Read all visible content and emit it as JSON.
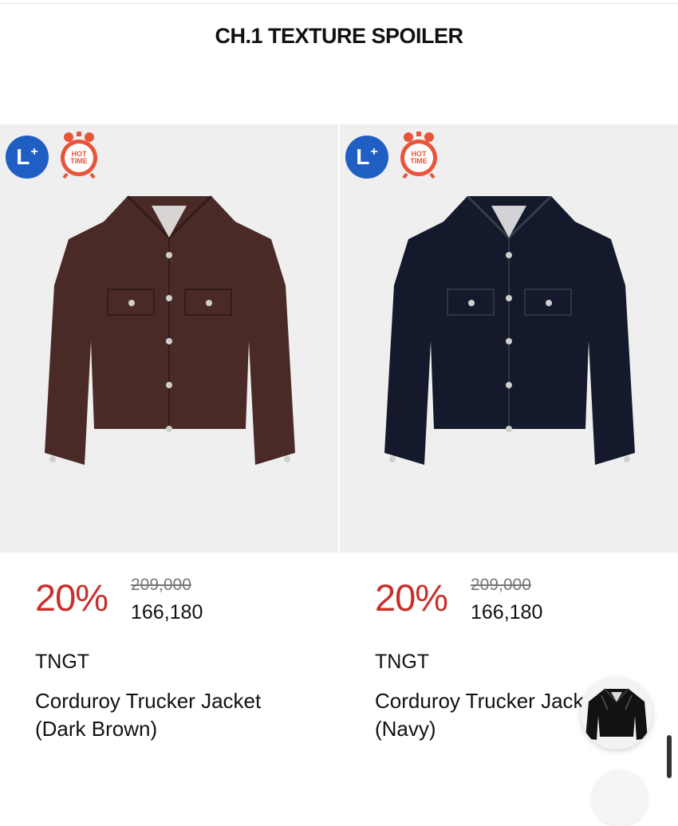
{
  "header": {
    "title": "CH.1 TEXTURE SPOILER"
  },
  "badges": {
    "lplus_label": "L",
    "hot_line1": "HOT",
    "hot_line2": "TIME"
  },
  "colors": {
    "discount": "#c9302c",
    "lplus_badge": "#1f5fc4",
    "hot_badge": "#e8553a"
  },
  "products": [
    {
      "image_icon": "brown-corduroy-jacket",
      "color_hex": "#4a2a26",
      "discount": "20%",
      "original_price": "209,000",
      "sale_price": "166,180",
      "brand": "TNGT",
      "name_line1": "Corduroy Trucker Jacket",
      "name_line2": "(Dark Brown)"
    },
    {
      "image_icon": "navy-corduroy-jacket",
      "color_hex": "#141a2b",
      "discount": "20%",
      "original_price": "209,000",
      "sale_price": "166,180",
      "brand": "TNGT",
      "name_line1": "Corduroy Trucker Jacket",
      "name_line2": "(Navy)"
    }
  ],
  "floating": {
    "icon": "leather-jacket-thumbnail"
  }
}
